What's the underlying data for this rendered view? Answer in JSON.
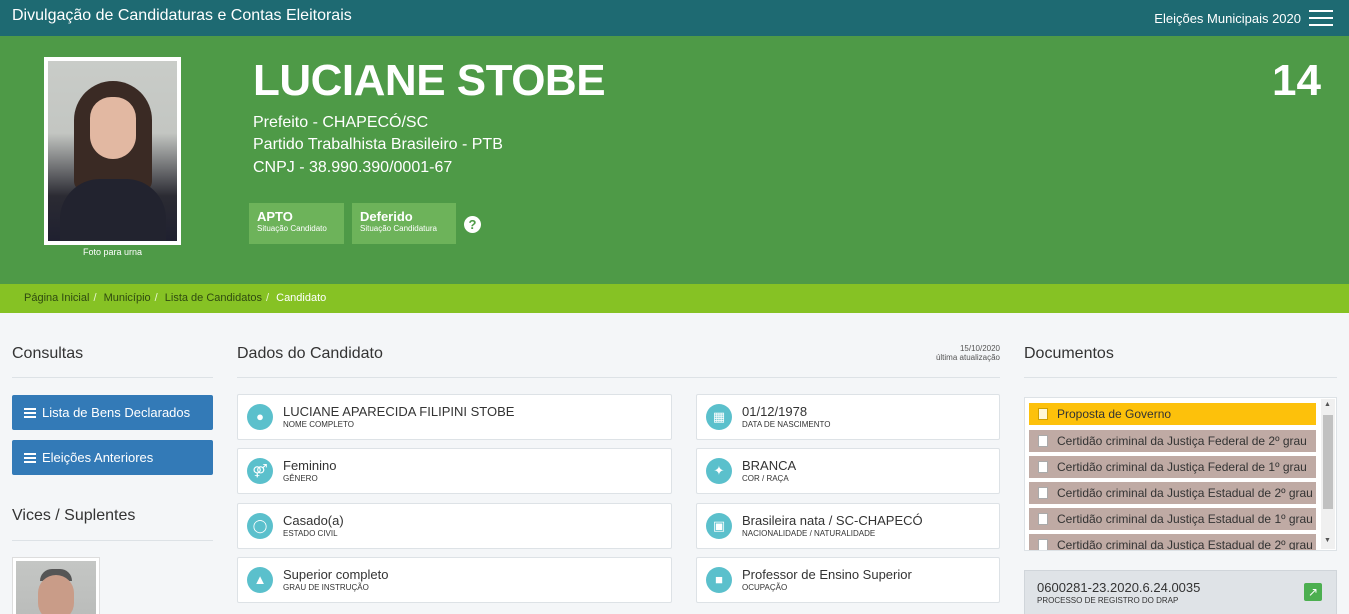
{
  "topbar": {
    "brand": "Divulgação de Candidaturas e Contas Eleitorais",
    "election": "Eleições Municipais 2020"
  },
  "candidate": {
    "name": "LUCIANE STOBE",
    "number": "14",
    "office": "Prefeito - CHAPECÓ/SC",
    "party": "Partido Trabalhista Brasileiro - PTB",
    "cnpj": "CNPJ - 38.990.390/0001-67",
    "photo_caption": "Foto para urna",
    "status": [
      {
        "value": "APTO",
        "label": "Situação Candidato"
      },
      {
        "value": "Deferido",
        "label": "Situação Candidatura"
      }
    ],
    "help": "?"
  },
  "breadcrumb": [
    "Página Inicial",
    "Município",
    "Lista de Candidatos",
    "Candidato"
  ],
  "consultas": {
    "title": "Consultas",
    "buttons": [
      "Lista de Bens Declarados",
      "Eleições Anteriores"
    ]
  },
  "vices": {
    "title": "Vices / Suplentes"
  },
  "dados": {
    "title": "Dados do Candidato",
    "updated_date": "15/10/2020",
    "updated_label": "última atualização",
    "fields": [
      {
        "value": "LUCIANE APARECIDA FILIPINI STOBE",
        "label": "NOME COMPLETO",
        "icon": "user-icon"
      },
      {
        "value": "01/12/1978",
        "label": "DATA DE NASCIMENTO",
        "icon": "calendar-icon"
      },
      {
        "value": "Feminino",
        "label": "GÊNERO",
        "icon": "gender-icon"
      },
      {
        "value": "BRANCA",
        "label": "COR / RAÇA",
        "icon": "person-icon"
      },
      {
        "value": "Casado(a)",
        "label": "ESTADO CIVIL",
        "icon": "ring-icon"
      },
      {
        "value": "Brasileira nata / SC-CHAPECÓ",
        "label": "NACIONALIDADE / NATURALIDADE",
        "icon": "map-icon"
      },
      {
        "value": "Superior completo",
        "label": "GRAU DE INSTRUÇÃO",
        "icon": "graduation-cap-icon"
      },
      {
        "value": "Professor de Ensino Superior",
        "label": "OCUPAÇÃO",
        "icon": "institution-icon"
      }
    ]
  },
  "documentos": {
    "title": "Documentos",
    "items": [
      "Proposta de Governo",
      "Certidão criminal da Justiça Federal de 2º grau",
      "Certidão criminal da Justiça Federal de 1º grau",
      "Certidão criminal da Justiça Estadual de 2º grau",
      "Certidão criminal da Justiça Estadual de 1º grau",
      "Certidão criminal da Justiça Estadual de 2º grau"
    ],
    "process_value": "0600281-23.2020.6.24.0035",
    "process_label": "PROCESSO DE REGISTRO DO DRAP"
  },
  "colors": {
    "topbar": "#1e6a72",
    "hero": "#4e9a47",
    "crumbbar": "#86c224",
    "button": "#337ab7",
    "icon": "#5bc0cc",
    "active_doc": "#fdc10b"
  }
}
